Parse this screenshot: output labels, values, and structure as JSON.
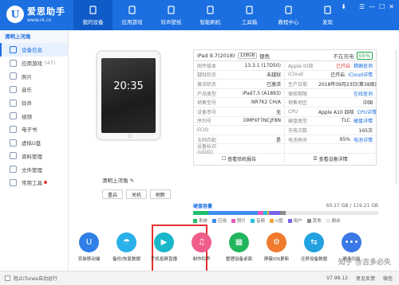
{
  "header": {
    "logo_mark": "U",
    "title": "爱思助手",
    "url": "www.i4.cn",
    "nav": [
      {
        "label": "我的设备",
        "icon": "phone-icon",
        "active": true
      },
      {
        "label": "应用游戏",
        "icon": "apps-icon"
      },
      {
        "label": "铃声壁纸",
        "icon": "music-icon"
      },
      {
        "label": "智能刷机",
        "icon": "flash-icon"
      },
      {
        "label": "工具箱",
        "icon": "toolbox-icon"
      },
      {
        "label": "教程中心",
        "icon": "tutorial-icon"
      },
      {
        "label": "发现",
        "icon": "discover-icon"
      }
    ]
  },
  "sidebar": {
    "device_title": "清明上河角",
    "items": [
      {
        "label": "设备信息",
        "count": "",
        "icon": "device-info-icon",
        "active": true
      },
      {
        "label": "应用游戏",
        "count": "(47)",
        "icon": "apps-icon"
      },
      {
        "label": "照片",
        "count": "",
        "icon": "photo-icon"
      },
      {
        "label": "音乐",
        "count": "",
        "icon": "music-icon"
      },
      {
        "label": "铃声",
        "count": "",
        "icon": "ringtone-icon"
      },
      {
        "label": "视频",
        "count": "",
        "icon": "video-icon"
      },
      {
        "label": "电子书",
        "count": "",
        "icon": "ebook-icon"
      },
      {
        "label": "虚拟U盘",
        "count": "",
        "icon": "udisk-icon"
      },
      {
        "label": "资料管理",
        "count": "",
        "icon": "data-icon"
      },
      {
        "label": "文件管理",
        "count": "",
        "icon": "file-icon"
      },
      {
        "label": "常用工具",
        "count": "",
        "icon": "tools-icon",
        "dot": true
      }
    ]
  },
  "device": {
    "screen_time": "20:35",
    "name": "清明上河角",
    "buttons": [
      "重启",
      "关机",
      "刷新"
    ]
  },
  "info": {
    "model": "iPad 9.7(2018)",
    "capacity": "128GB",
    "color": "银色",
    "charge_label": "不在充电",
    "charge_pct": "55%",
    "rows": [
      [
        {
          "k": "固件版本",
          "v": "13.3.1 (17D50)"
        },
        {
          "k": "Apple ID锁",
          "v": "已开启",
          "v2": "精确查询",
          "color": "red"
        }
      ],
      [
        {
          "k": "越狱状态",
          "v": "未越狱"
        },
        {
          "k": "iCloud",
          "v": "已开启",
          "v2": "iCloud详情",
          "color": "blue"
        }
      ],
      [
        {
          "k": "激活状态",
          "v": "已激活"
        },
        {
          "k": "生产日期",
          "v": "2018年09月23日(第38周)"
        }
      ],
      [
        {
          "k": "产品类型",
          "v": "iPad7,5 (A1893)"
        },
        {
          "k": "保修期限",
          "v": "在线查询",
          "color": "blue"
        }
      ],
      [
        {
          "k": "销售型号",
          "v": "NR7K2 CH/A"
        },
        {
          "k": "销售地区",
          "v": "中国"
        }
      ],
      [
        {
          "k": "设备串号",
          "v": "无"
        },
        {
          "k": "CPU",
          "v": "Apple A10 四核",
          "v2": "CPU详情",
          "color": "blue"
        }
      ],
      [
        {
          "k": "序列号",
          "v": "DMPXF7NCJF8N"
        },
        {
          "k": "硬盘类型",
          "v": "TLC",
          "v2": "硬盘详情",
          "color": "blue"
        }
      ],
      [
        {
          "k": "ECID",
          "v": ""
        },
        {
          "k": "充电次数",
          "v": "165次"
        }
      ],
      [
        {
          "k": "五码匹配",
          "v": "是"
        },
        {
          "k": "电池寿命",
          "v": "95%",
          "v2": "电池详情",
          "color": "blue"
        }
      ],
      [
        {
          "k": "设备标识(UDID)",
          "v": ""
        },
        {
          "k": "",
          "v": ""
        }
      ]
    ],
    "report_btn": "查看验机报告",
    "detail_btn": "查看设备详情"
  },
  "storage": {
    "title": "硬盘容量",
    "size": "60.17 GB / 119.21 GB",
    "segments": [
      {
        "name": "系统",
        "pct": 8,
        "color": "#1fbf6c"
      },
      {
        "name": "应用",
        "pct": 27,
        "color": "#3d8ef0"
      },
      {
        "name": "照片",
        "pct": 3,
        "color": "#e35ac4"
      },
      {
        "name": "音频",
        "pct": 2,
        "color": "#25c0d8"
      },
      {
        "name": "U盘",
        "pct": 1,
        "color": "#f2a43a"
      },
      {
        "name": "用户",
        "pct": 6,
        "color": "#7b61e8"
      },
      {
        "name": "其他",
        "pct": 3,
        "color": "#8c8c8c"
      }
    ],
    "free_label": "剩余"
  },
  "tools": [
    {
      "label": "安装移动端",
      "icon": "install-icon",
      "color": "#2f7fe6",
      "glyph": "U"
    },
    {
      "label": "备份/恢复数据",
      "icon": "umbrella-icon",
      "color": "#2ab0e8",
      "glyph": "☂"
    },
    {
      "label": "手机投屏直播",
      "icon": "screen-cast-icon",
      "color": "#19b7c9",
      "glyph": "▶"
    },
    {
      "label": "制作铃声",
      "icon": "ringtone-icon",
      "color": "#f05d8a",
      "glyph": "♫"
    },
    {
      "label": "整理设备桌面",
      "icon": "desktop-icon",
      "color": "#22b55c",
      "glyph": "▦"
    },
    {
      "label": "屏蔽iOS更新",
      "icon": "block-update-icon",
      "color": "#f07a2e",
      "glyph": "⚙"
    },
    {
      "label": "迁移设备数据",
      "icon": "migrate-icon",
      "color": "#21a1e0",
      "glyph": "⇆"
    },
    {
      "label": "更多功能",
      "icon": "more-icon",
      "color": "#3b78e7",
      "glyph": "•••"
    }
  ],
  "status": {
    "autorun": "阻止iTunes自动运行",
    "version": "V7.98.12",
    "feedback": "意见反馈",
    "wechat": "微信"
  },
  "watermark": "知乎 @吉多必失"
}
